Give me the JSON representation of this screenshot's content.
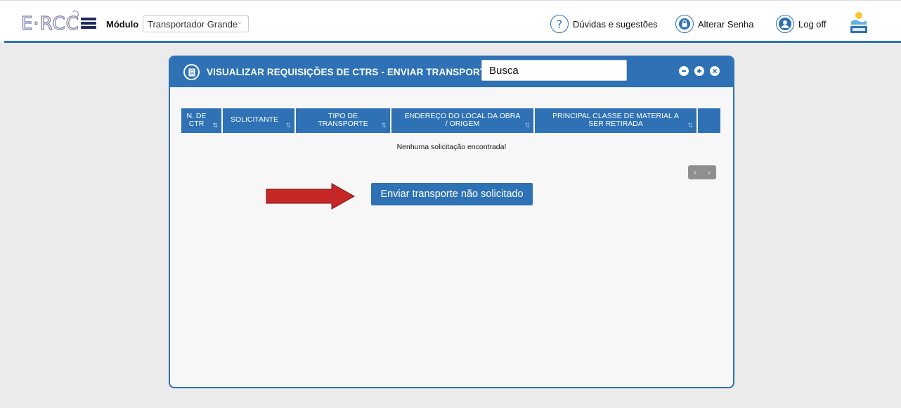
{
  "brand": {
    "logo_text": "E·RCC"
  },
  "module": {
    "label": "Módulo",
    "selected": "Transportador Grande"
  },
  "top_actions": {
    "help": "Dúvidas e sugestões",
    "change_password": "Alterar Senha",
    "logoff": "Log off"
  },
  "panel": {
    "title": "VISUALIZAR REQUISIÇÕES DE CTRS - ENVIAR TRANSPORTE",
    "search_placeholder": "Busca",
    "columns": [
      "N. DE CTR",
      "SOLICITANTE",
      "TIPO DE TRANSPORTE",
      "ENDEREÇO DO LOCAL DA OBRA / ORIGEM",
      "PRINCIPAL CLASSE DE MATERIAL A SER RETIRADA"
    ],
    "empty_message": "Nenhuma solicitação encontrada!",
    "send_button": "Enviar transporte não solicitado"
  },
  "colors": {
    "accent": "#2e72b5",
    "arrow": "#c62828",
    "background": "#ebebeb"
  }
}
